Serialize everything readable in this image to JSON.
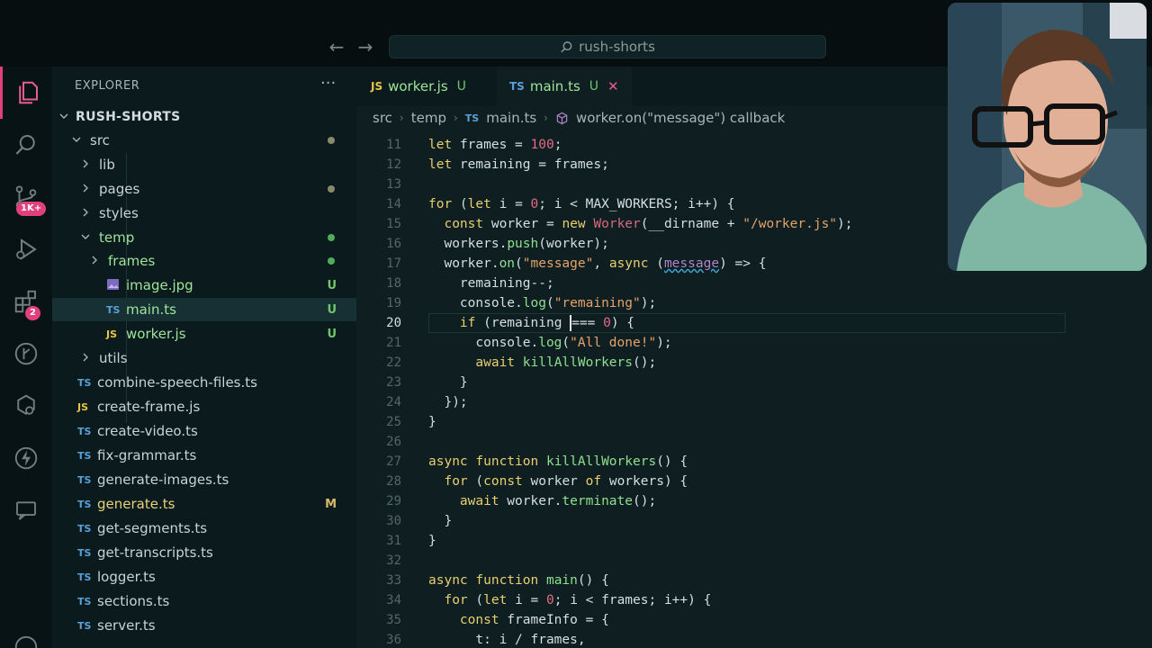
{
  "titlebar": {
    "search": "rush-shorts",
    "back_icon": "arrow-left-icon",
    "forward_icon": "arrow-right-icon"
  },
  "activity_bar": {
    "items": [
      {
        "name": "explorer-icon",
        "active": true
      },
      {
        "name": "search-icon"
      },
      {
        "name": "source-control-icon",
        "badge": "1K+"
      },
      {
        "name": "run-debug-icon"
      },
      {
        "name": "extensions-icon",
        "badge": "2"
      },
      {
        "name": "git-graph-icon"
      },
      {
        "name": "remote-explorer-icon"
      },
      {
        "name": "lightning-icon"
      },
      {
        "name": "chat-icon"
      },
      {
        "name": "account-icon"
      }
    ],
    "accent": "#e0407b"
  },
  "sidebar": {
    "title": "EXPLORER",
    "more": "···",
    "root": "RUSH-SHORTS",
    "tree": [
      {
        "label": "src",
        "kind": "folder-open",
        "depth": 1,
        "dot": "#8a8a6a"
      },
      {
        "label": "lib",
        "kind": "folder",
        "depth": 2
      },
      {
        "label": "pages",
        "kind": "folder",
        "depth": 2,
        "dot": "#8a8a6a"
      },
      {
        "label": "styles",
        "kind": "folder",
        "depth": 2
      },
      {
        "label": "temp",
        "kind": "folder-open",
        "depth": 2,
        "dot": "#4fae5a",
        "green": true
      },
      {
        "label": "frames",
        "kind": "folder",
        "depth": 3,
        "dot": "#4fae5a",
        "green": true
      },
      {
        "label": "image.jpg",
        "kind": "image",
        "depth": 3,
        "git": "U",
        "green": true
      },
      {
        "label": "main.ts",
        "kind": "ts",
        "depth": 3,
        "git": "U",
        "green": true,
        "selected": true
      },
      {
        "label": "worker.js",
        "kind": "js",
        "depth": 3,
        "git": "U",
        "green": true
      },
      {
        "label": "utils",
        "kind": "folder",
        "depth": 2
      },
      {
        "label": "combine-speech-files.ts",
        "kind": "ts",
        "depth": 1
      },
      {
        "label": "create-frame.js",
        "kind": "js",
        "depth": 1
      },
      {
        "label": "create-video.ts",
        "kind": "ts",
        "depth": 1
      },
      {
        "label": "fix-grammar.ts",
        "kind": "ts",
        "depth": 1
      },
      {
        "label": "generate-images.ts",
        "kind": "ts",
        "depth": 1
      },
      {
        "label": "generate.ts",
        "kind": "ts",
        "depth": 1,
        "git": "M",
        "modified": true
      },
      {
        "label": "get-segments.ts",
        "kind": "ts",
        "depth": 1
      },
      {
        "label": "get-transcripts.ts",
        "kind": "ts",
        "depth": 1
      },
      {
        "label": "logger.ts",
        "kind": "ts",
        "depth": 1
      },
      {
        "label": "sections.ts",
        "kind": "ts",
        "depth": 1
      },
      {
        "label": "server.ts",
        "kind": "ts",
        "depth": 1
      }
    ]
  },
  "tabs": [
    {
      "type": "JS",
      "label": "worker.js",
      "state": "U",
      "active": false
    },
    {
      "type": "TS",
      "label": "main.ts",
      "state": "U",
      "active": true,
      "close": "✕"
    }
  ],
  "breadcrumb": [
    "src",
    "temp",
    "main.ts",
    "worker.on(\"message\") callback"
  ],
  "breadcrumb_ts": "TS",
  "code": {
    "current_line": 20,
    "lines": [
      {
        "n": "11",
        "html": "<span class=\"kw\">let</span> frames = <span class=\"num\">100</span>;"
      },
      {
        "n": "12",
        "html": "<span class=\"kw\">let</span> remaining = frames;"
      },
      {
        "n": "13",
        "html": ""
      },
      {
        "n": "14",
        "html": "<span class=\"kw\">for</span> (<span class=\"kw\">let</span> i = <span class=\"num\">0</span>; i &lt; MAX_WORKERS; i++) {"
      },
      {
        "n": "15",
        "html": "  <span class=\"kw\">const</span> worker = <span class=\"kw\">new</span> <span class=\"cls\">Worker</span>(__dirname + <span class=\"str\">\"/worker.js\"</span>);"
      },
      {
        "n": "16",
        "html": "  workers.<span class=\"fn\">push</span>(worker);"
      },
      {
        "n": "17",
        "html": "  worker.<span class=\"fn\">on</span>(<span class=\"str\">\"message\"</span>, <span class=\"kw\">async</span> (<span class=\"param squig\">message</span>) =&gt; {"
      },
      {
        "n": "18",
        "html": "    remaining--;"
      },
      {
        "n": "19",
        "html": "    console.<span class=\"fn\">log</span>(<span class=\"str\">\"remaining\"</span>);"
      },
      {
        "n": "20",
        "html": "    <span class=\"kw\">if</span> (remaining <span class=\"cursor\"></span>=== <span class=\"num\">0</span>) {"
      },
      {
        "n": "21",
        "html": "      console.<span class=\"fn\">log</span>(<span class=\"str\">\"All done!\"</span>);"
      },
      {
        "n": "22",
        "html": "      <span class=\"kw\">await</span> <span class=\"fn\">killAllWorkers</span>();"
      },
      {
        "n": "23",
        "html": "    }"
      },
      {
        "n": "24",
        "html": "  });"
      },
      {
        "n": "25",
        "html": "}"
      },
      {
        "n": "26",
        "html": ""
      },
      {
        "n": "27",
        "html": "<span class=\"kw\">async</span> <span class=\"kw\">function</span> <span class=\"fn\">killAllWorkers</span>() {"
      },
      {
        "n": "28",
        "html": "  <span class=\"kw\">for</span> (<span class=\"kw\">const</span> worker <span class=\"kw\">of</span> workers) {"
      },
      {
        "n": "29",
        "html": "    <span class=\"kw\">await</span> worker.<span class=\"fn\">terminate</span>();"
      },
      {
        "n": "30",
        "html": "  }"
      },
      {
        "n": "31",
        "html": "}"
      },
      {
        "n": "32",
        "html": ""
      },
      {
        "n": "33",
        "html": "<span class=\"kw\">async</span> <span class=\"kw\">function</span> <span class=\"fn\">main</span>() {"
      },
      {
        "n": "34",
        "html": "  <span class=\"kw\">for</span> (<span class=\"kw\">let</span> i = <span class=\"num\">0</span>; i &lt; frames; i++) {"
      },
      {
        "n": "35",
        "html": "    <span class=\"kw\">const</span> frameInfo = {"
      },
      {
        "n": "36",
        "html": "      t: i / frames,"
      }
    ]
  },
  "webcam": {
    "description_icon": "webcam-person-icon"
  }
}
